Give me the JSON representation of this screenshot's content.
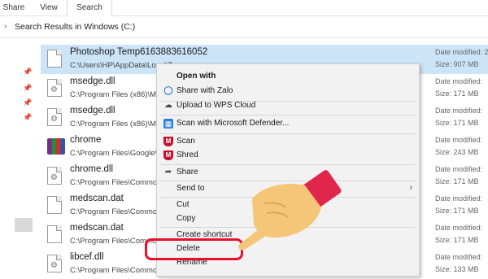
{
  "ribbon": {
    "tabs": [
      "Share",
      "View",
      "Search"
    ],
    "active_tab": "Search"
  },
  "address": {
    "path": "Search Results in Windows (C:)"
  },
  "files": [
    {
      "name": "Photoshop Temp6163883616052",
      "path": "C:\\Users\\HP\\AppData\\Local\\T",
      "date_label": "Date modified:",
      "date": "2",
      "size_label": "Size:",
      "size": "907 MB",
      "selected": true,
      "icon": "blank-file-icon"
    },
    {
      "name": "msedge.dll",
      "path": "C:\\Program Files (x86)\\Mic",
      "date_label": "Date modified:",
      "date": "",
      "size_label": "Size:",
      "size": "171 MB",
      "selected": false,
      "icon": "dll-file-icon"
    },
    {
      "name": "msedge.dll",
      "path": "C:\\Program Files (x86)\\Mic",
      "date_label": "Date modified:",
      "date": "",
      "size_label": "Size:",
      "size": "171 MB",
      "selected": false,
      "icon": "dll-file-icon"
    },
    {
      "name": "chrome",
      "path": "C:\\Program Files\\Google\\C",
      "date_label": "Date modified:",
      "date": "",
      "size_label": "Size:",
      "size": "243 MB",
      "selected": false,
      "icon": "archive-icon"
    },
    {
      "name": "chrome.dll",
      "path": "C:\\Program Files\\Commor",
      "date_label": "Date modified:",
      "date": "",
      "size_label": "Size:",
      "size": "171 MB",
      "selected": false,
      "icon": "dll-file-icon"
    },
    {
      "name": "medscan.dat",
      "path": "C:\\Program Files\\Commor",
      "date_label": "Date modified:",
      "date": "",
      "size_label": "Size:",
      "size": "171 MB",
      "selected": false,
      "icon": "blank-file-icon"
    },
    {
      "name": "medscan.dat",
      "path": "C:\\Program Files\\Commor",
      "date_label": "Date modified:",
      "date": "",
      "size_label": "Size:",
      "size": "171 MB",
      "selected": false,
      "icon": "blank-file-icon"
    },
    {
      "name": "libcef.dll",
      "path": "C:\\Program Files\\Commor",
      "date_label": "Date modified:",
      "date": "",
      "size_label": "Size:",
      "size": "133 MB",
      "selected": false,
      "icon": "dll-file-icon"
    }
  ],
  "context_menu": {
    "open_with": "Open with",
    "share_zalo": "Share with Zalo",
    "upload_wps": "Upload to WPS Cloud",
    "scan_defender": "Scan with Microsoft Defender...",
    "scan": "Scan",
    "shred": "Shred",
    "share": "Share",
    "send_to": "Send to",
    "cut": "Cut",
    "copy": "Copy",
    "create_shortcut": "Create shortcut",
    "delete": "Delete",
    "rename": "Rename"
  },
  "colors": {
    "selection": "#cce4f7",
    "highlight": "#e8102c",
    "hand": "#f5c678",
    "cuff": "#e0264a"
  }
}
